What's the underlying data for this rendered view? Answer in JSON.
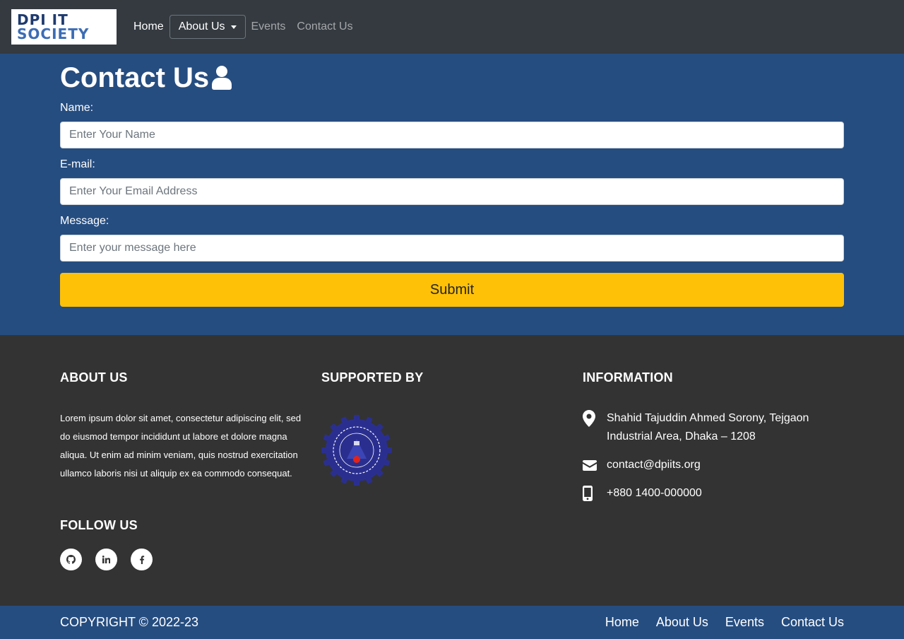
{
  "navbar": {
    "logo_line1": "DPI IT",
    "logo_line2": "SOCIETY",
    "home": "Home",
    "about": "About Us",
    "events": "Events",
    "contact": "Contact Us"
  },
  "contact_section": {
    "title": "Contact Us",
    "title_icon": "user-icon",
    "name_label": "Name:",
    "name_placeholder": "Enter Your Name",
    "email_label": "E-mail:",
    "email_placeholder": "Enter Your Email Address",
    "message_label": "Message:",
    "message_placeholder": "Enter your message here",
    "submit": "Submit"
  },
  "footer": {
    "about_heading": "ABOUT US",
    "about_text": "Lorem ipsum dolor sit amet, consectetur adipiscing elit, sed do eiusmod tempor incididunt ut labore et dolore magna aliqua. Ut enim ad minim veniam, quis nostrud exercitation ullamco laboris nisi ut aliquip ex ea commodo consequat.",
    "follow_heading": "FOLLOW US",
    "social": [
      {
        "icon": "github-icon",
        "glyph": "⌥"
      },
      {
        "icon": "linkedin-icon",
        "glyph": "in"
      },
      {
        "icon": "facebook-icon",
        "glyph": "f"
      }
    ],
    "supported_heading": "SUPPORTED BY",
    "info_heading": "INFORMATION",
    "address": "Shahid Tajuddin Ahmed Sorony, Tejgaon Industrial Area, Dhaka – 1208",
    "email": "contact@dpiits.org",
    "phone": "+880 1400-000000"
  },
  "bottom_bar": {
    "copyright": "COPYRIGHT © 2022-23",
    "links": [
      "Home",
      "About Us",
      "Events",
      "Contact Us"
    ]
  },
  "colors": {
    "navbar_bg": "#343a40",
    "section_bg": "#264d80",
    "footer_bg": "#333333",
    "submit_bg": "#ffc107"
  }
}
